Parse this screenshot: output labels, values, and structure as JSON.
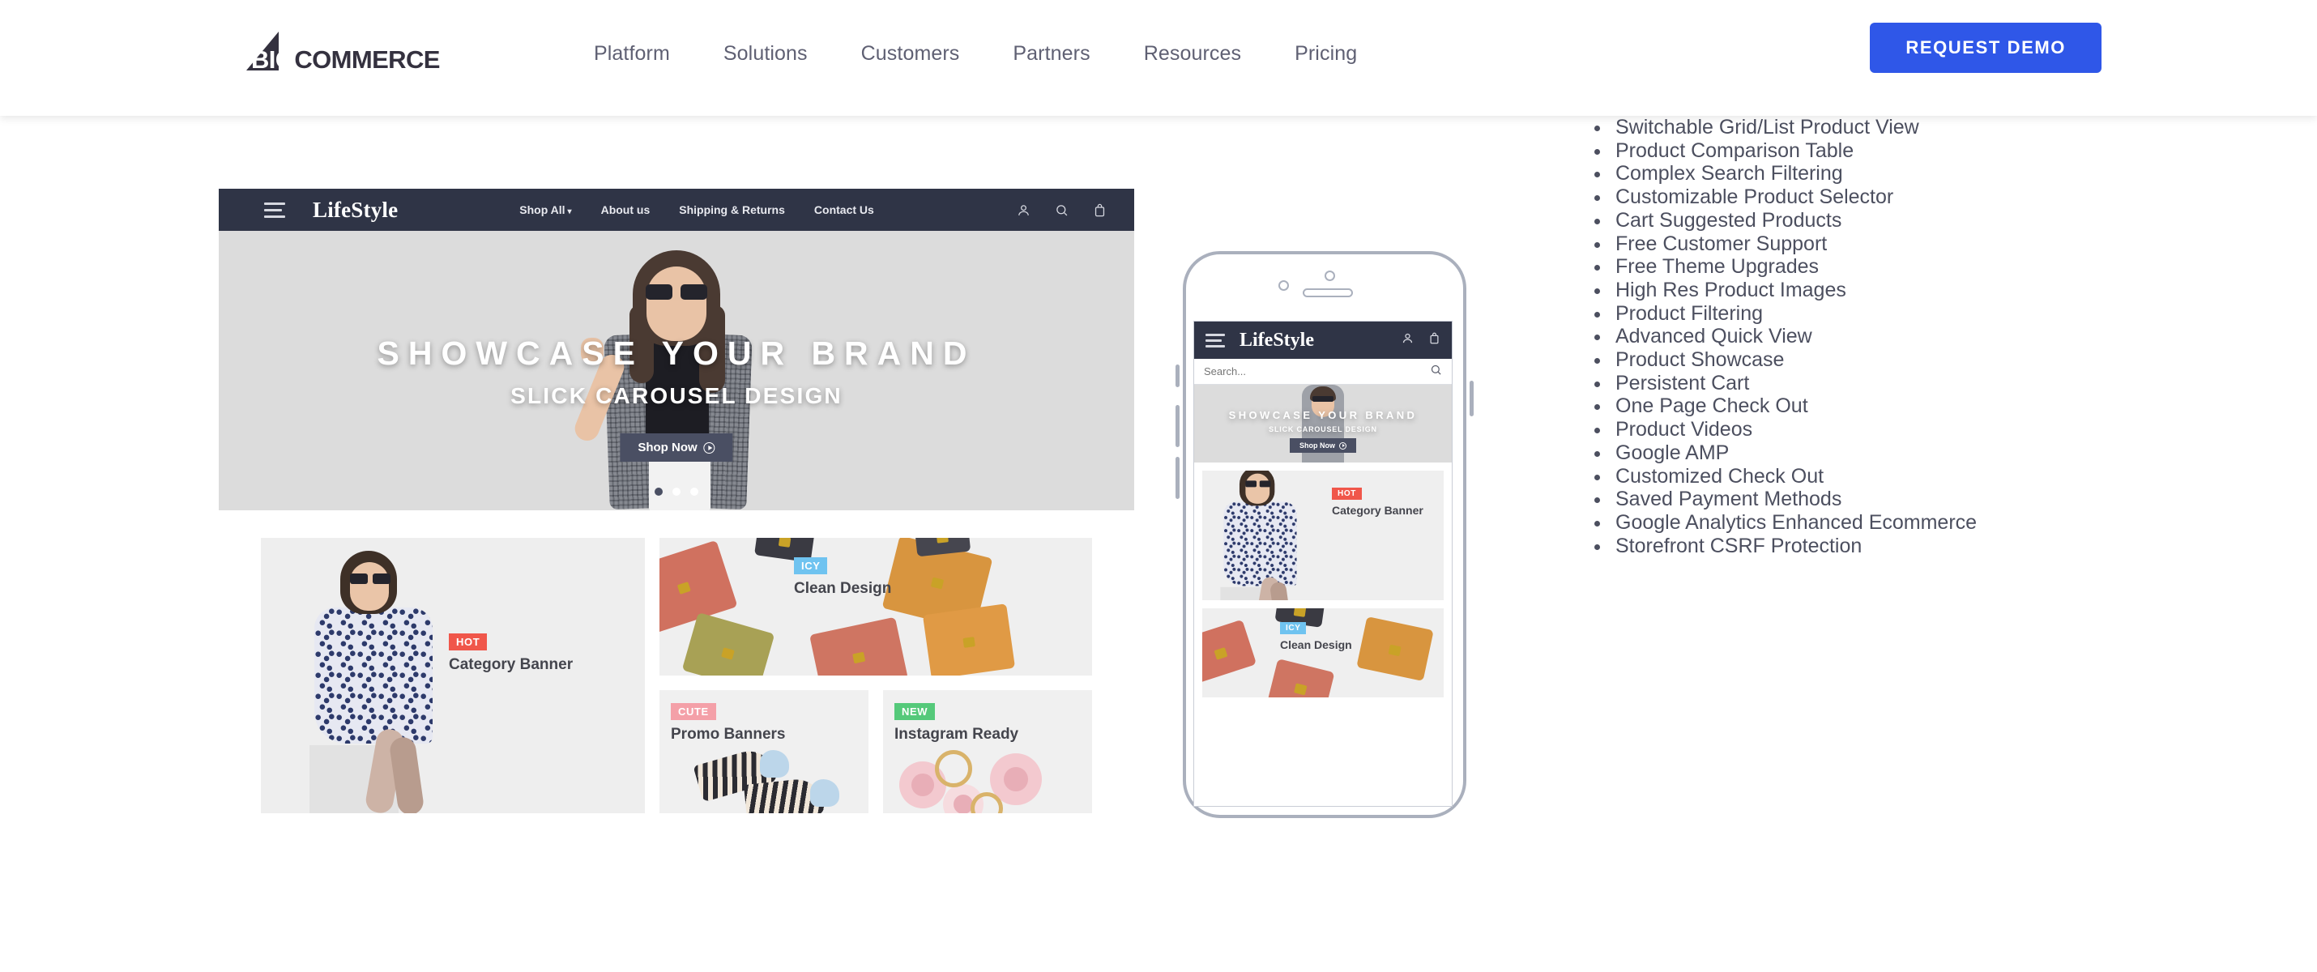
{
  "site_header": {
    "logo": {
      "text_big": "BIG",
      "text_commerce": "COMMERCE",
      "full": "BIGCOMMERCE"
    },
    "nav": [
      {
        "label": "Platform"
      },
      {
        "label": "Solutions"
      },
      {
        "label": "Customers"
      },
      {
        "label": "Partners"
      },
      {
        "label": "Resources"
      },
      {
        "label": "Pricing"
      }
    ],
    "cta": {
      "label": "REQUEST DEMO",
      "color": "#2f57e8"
    }
  },
  "storefront_preview": {
    "brand": "LifeStyle",
    "nav": [
      {
        "label": "Shop All",
        "has_caret": true
      },
      {
        "label": "About us",
        "has_caret": false
      },
      {
        "label": "Shipping & Returns",
        "has_caret": false
      },
      {
        "label": "Contact Us",
        "has_caret": false
      }
    ],
    "icons": [
      "account-icon",
      "search-icon",
      "cart-icon"
    ],
    "hero": {
      "title": "SHOWCASE YOUR BRAND",
      "subtitle": "SLICK CAROUSEL DESIGN",
      "cta": "Shop Now",
      "carousel_dots": 3,
      "active_dot": 1
    },
    "tiles": [
      {
        "badge": "HOT",
        "badge_color": "#f0564a",
        "label": "Category Banner"
      },
      {
        "badge": "ICY",
        "badge_color": "#6fc3f0",
        "label": "Clean Design"
      },
      {
        "badge": "CUTE",
        "badge_color": "#f4a0a8",
        "label": "Promo Banners"
      },
      {
        "badge": "NEW",
        "badge_color": "#55c97a",
        "label": "Instagram Ready"
      }
    ],
    "header_color": "#2f3446"
  },
  "mobile_preview": {
    "brand": "LifeStyle",
    "search_placeholder": "Search...",
    "icons": [
      "account-icon",
      "cart-icon",
      "search-icon"
    ],
    "hero": {
      "title": "SHOWCASE YOUR BRAND",
      "subtitle": "SLICK CAROUSEL DESIGN",
      "cta": "Shop Now"
    },
    "tiles": [
      {
        "badge": "HOT",
        "badge_color": "#f0564a",
        "label": "Category Banner"
      },
      {
        "badge": "ICY",
        "badge_color": "#6fc3f0",
        "label": "Clean Design"
      }
    ]
  },
  "features": {
    "items": [
      "Switchable Grid/List Product View",
      "Product Comparison Table",
      "Complex Search Filtering",
      "Customizable Product Selector",
      "Cart Suggested Products",
      "Free Customer Support",
      "Free Theme Upgrades",
      "High Res Product Images",
      "Product Filtering",
      "Advanced Quick View",
      "Product Showcase",
      "Persistent Cart",
      "One Page Check Out",
      "Product Videos",
      "Google AMP",
      "Customized Check Out",
      "Saved Payment Methods",
      "Google Analytics Enhanced Ecommerce",
      "Storefront CSRF Protection"
    ]
  }
}
